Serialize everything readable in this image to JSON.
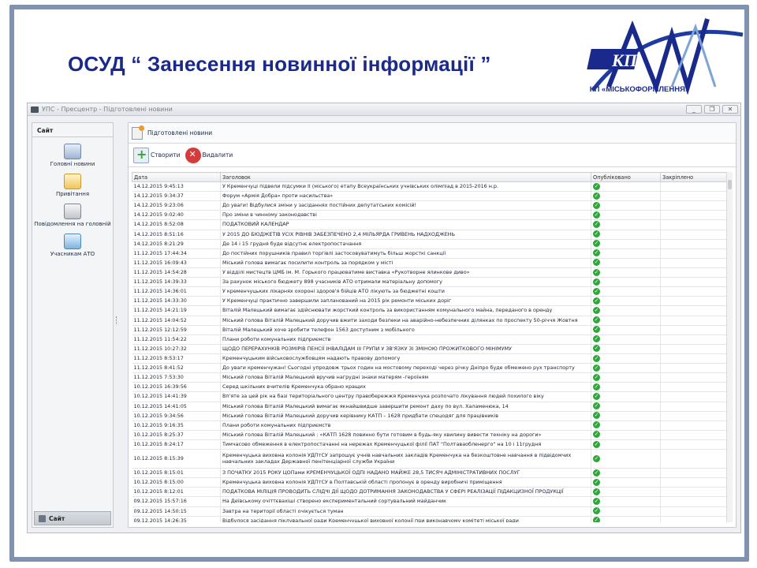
{
  "slide": {
    "title": "ОСУД “ Занесення новинної інформації ”",
    "logo_text": "КП",
    "logo_caption": "КП «МІСЬКОФОРМЛЕННЯ»"
  },
  "window": {
    "title": "УПС - Пресцентр - Підготовлені новини",
    "buttons": [
      "_",
      "❐",
      "✕"
    ]
  },
  "sidebar": {
    "header": "Сайт",
    "items": [
      {
        "label": "Головні новини",
        "icon": "headline-news-icon"
      },
      {
        "label": "Привітання",
        "icon": "greetings-icon"
      },
      {
        "label": "Повідомлення на головній",
        "icon": "main-messages-icon"
      },
      {
        "label": "Учасникам АТО",
        "icon": "ato-participants-icon"
      }
    ],
    "footer": "Сайт"
  },
  "tab": {
    "label": "Підготовлені новини"
  },
  "toolbar": {
    "create_label": "Створити",
    "delete_label": "Видалити"
  },
  "table": {
    "columns": [
      "Дата",
      "Заголовок",
      "Опубліковано",
      "Закріплено"
    ],
    "rows": [
      {
        "date": "14.12.2015 9:45:13",
        "title": "У Кременчуці  підвели підсумки ІІ (міського) етапу Всеукраїнських учнівських олімпіад  в 2015-2016 н.р."
      },
      {
        "date": "14.12.2015 9:34:37",
        "title": "Форум «Армія Добра» проти насильства»"
      },
      {
        "date": "14.12.2015 9:23:06",
        "title": "До уваги! Відбулися зміни у засіданнях постійних депутатських комісій!"
      },
      {
        "date": "14.12.2015 9:02:40",
        "title": "Про зміни в чинному законодавстві"
      },
      {
        "date": "14.12.2015 8:52:08",
        "title": "ПОДАТКОВИЙ КАЛЕНДАР"
      },
      {
        "date": "14.12.2015 8:51:16",
        "title": "У 2015 ДО БЮДЖЕТІВ УСІХ РІВНІВ ЗАБЕЗПЕЧЕНО 2,4 МІЛЬЯРДА ГРИВЕНЬ НАДХОДЖЕНЬ"
      },
      {
        "date": "14.12.2015 8:21:29",
        "title": "Де 14 і 15 грудня буде відсутнє електропостачання"
      },
      {
        "date": "11.12.2015 17:44:34",
        "title": "До постійних порушників правил торгівлі застосовуватимуть більш жорсткі санкції"
      },
      {
        "date": "11.12.2015 16:09:43",
        "title": "Міський голова вимагає посилити контроль за порядком у місті"
      },
      {
        "date": "11.12.2015 14:54:28",
        "title": "У  відділі мистецтв ЦМБ ім. М. Горького працюватиме виставка «Рукотворне ялинкове диво»"
      },
      {
        "date": "11.12.2015 14:39:33",
        "title": "За рахунок  міського бюджету 898 учасників АТО отримали матеріальну допомогу"
      },
      {
        "date": "11.12.2015 14:36:01",
        "title": "У кременчуцьких лікарнях охороні здоров'я бійців АТО лікують за бюджетні кошти"
      },
      {
        "date": "11.12.2015 14:33:30",
        "title": "У Кременчуці практично завершили запланований на 2015 рік  ремонти міських доріг"
      },
      {
        "date": "11.12.2015 14:21:19",
        "title": "Віталій Малецький вимагає здійснювати жорсткий контроль за використанням комунального майна, переданого в оренду"
      },
      {
        "date": "11.12.2015 14:04:52",
        "title": "Міський голова Віталій Малецький доручив вжити заходи безпеки на аварійно-небезпечних ділянках по проспекту 50-річчя Жовтня"
      },
      {
        "date": "11.12.2015 12:12:59",
        "title": "Віталій Малецький хоче зробити телефон 1563 доступним з мобільного"
      },
      {
        "date": "11.12.2015 11:54:22",
        "title": "Плани роботи комунальних підприємств"
      },
      {
        "date": "11.12.2015 10:27:32",
        "title": "ЩОДО ПЕРЕРАХУНКІВ РОЗМІРІВ ПЕНСІЇ ІНВАЛІДАМ ІІІ ГРУПИ У ЗВ'ЯЗКУ ЗІ ЗМІНОЮ ПРОЖИТКОВОГО МІНІМУМУ"
      },
      {
        "date": "11.12.2015 8:53:17",
        "title": "Кременчуцьким військовослужбовцям надають правову допомогу"
      },
      {
        "date": "11.12.2015 8:41:52",
        "title": "До уваги кременчужан! Сьогодні упродовж трьох годин на мостовому переході  через річку Дніпро буде обмежено рух транспорту"
      },
      {
        "date": "11.12.2015 7:53:30",
        "title": "Міський голова Віталій Малецький вручив нагрудні знаки матерям -героїням"
      },
      {
        "date": "10.12.2015 16:39:56",
        "title": "Серед шкільних вчителів Кременчука обрано кращих"
      },
      {
        "date": "10.12.2015 14:41:39",
        "title": "Вп'яте за цей рік на базі  територіального центру правобережжя Кременчука розпочато лікування людей похилого віку"
      },
      {
        "date": "10.12.2015 14:41:05",
        "title": "Міський голова Віталій Малецький вимагає  якнайшвидше завершити  ремонт даху по вул. Халаменюка, 14"
      },
      {
        "date": "10.12.2015 9:34:56",
        "title": "Міський голова Віталій Малецький доручив керівнику КАТП – 1628 придбати спецодяг для працівників"
      },
      {
        "date": "10.12.2015 9:16:35",
        "title": "Плани роботи комунальних підприємств"
      },
      {
        "date": "10.12.2015 8:25:37",
        "title": "Міський голова Віталій Малецький :  «КАТП 1628 повинно бути готовим в будь-яку хвилину вивести техніку на дороги»"
      },
      {
        "date": "10.12.2015 8:24:17",
        "title": "Тимчасово обмеження в електропостачанні  на нережах Кременчуцької філії ПАТ \"Полтаваобленерго\" на 10 і 11грудня"
      },
      {
        "date": "10.12.2015 8:15:39",
        "title": "Кременчуцька виховна колонія УДПтСУ запрошує учнів навчальних закладів Кременчука  на безкоштовне навчання в підвідомчих навчальних закладах Державної пенітенціарної служби України",
        "tall": true
      },
      {
        "date": "10.12.2015 8:15:01",
        "title": "З ПОЧАТКУ 2015 РОКУ ЦОПами КРЕМЕНЧУЦЬКОЇ ОДПІ НАДАНО МАЙЖЕ        28,5 ТИСЯЧ АДМІНІСТРАТИВНИХ ПОСЛУГ"
      },
      {
        "date": "10.12.2015 8:15:00",
        "title": "Кременчуцька виховна колонія УДПтСУ в Полтавській області пропонує в оренду  виробничі приміщення"
      },
      {
        "date": "10.12.2015 8:12:01",
        "title": "ПОДАТКОВА МІЛІЦІЯ ПРОВОДИТЬ СЛІДЧІ ДІЇ ЩОДО ДОТРИМАННЯ ЗАКОНОДАВСТВА У СФЕРІ РЕАЛІЗАЦІЇ ПІДАКЦИЗНОЇ ПРОДУКЦІЇ"
      },
      {
        "date": "09.12.2015 15:57:16",
        "title": "На Деївському очіттєвахіші створено експериментальний сортувальний майданчик"
      },
      {
        "date": "09.12.2015 14:50:15",
        "title": "Завтра на території області очікується туман"
      },
      {
        "date": "09.12.2015 14:26:35",
        "title": "Відбулося засідання піклувальної ради Кременчуцької  виховної колонії при  виконавчому комітеті міської ради"
      }
    ],
    "published_mark": "✓"
  }
}
